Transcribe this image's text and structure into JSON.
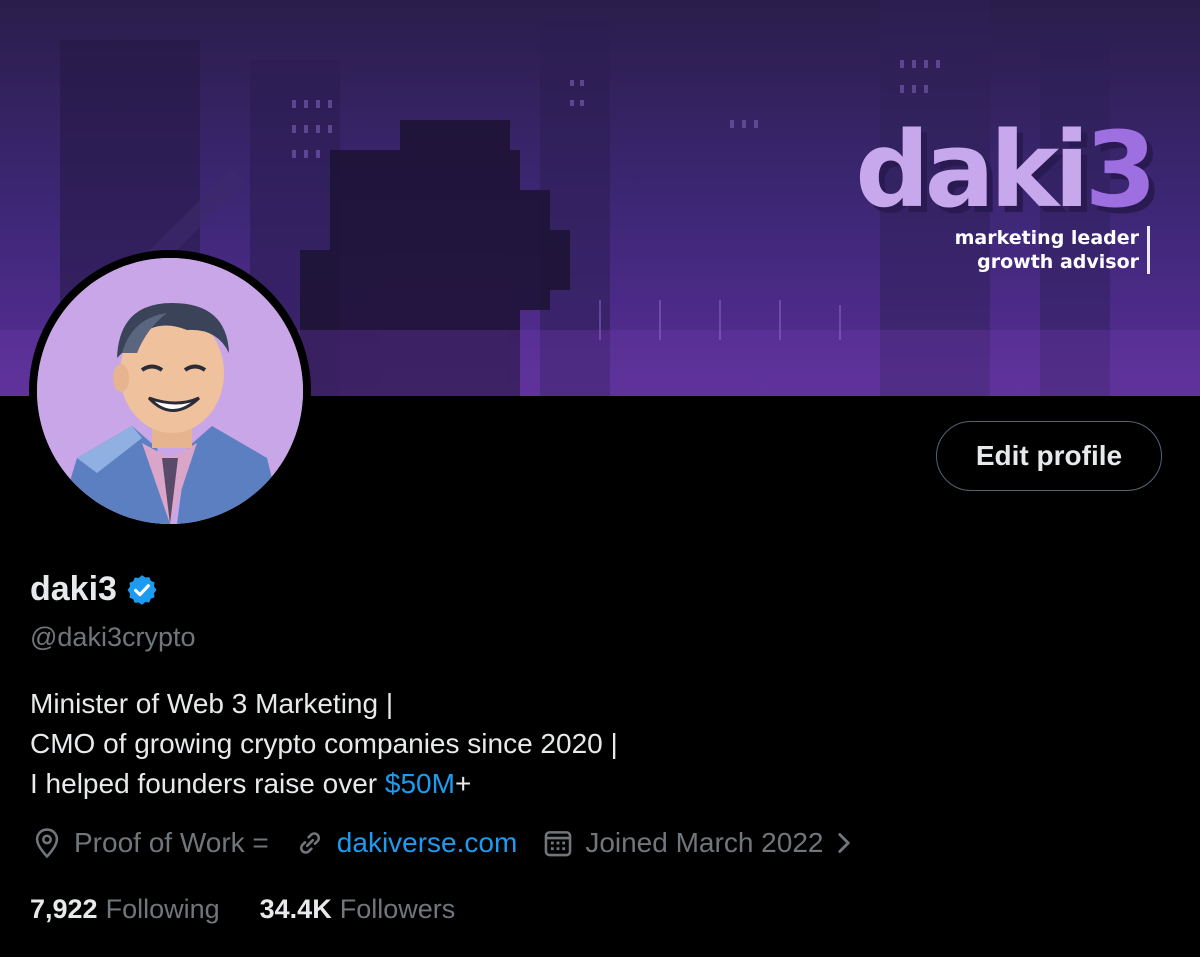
{
  "banner": {
    "brand_name_main": "daki",
    "brand_name_accent": "3",
    "tagline_line1": "marketing leader",
    "tagline_line2": "growth advisor"
  },
  "profile": {
    "display_name": "daki3",
    "handle": "@daki3crypto",
    "edit_button_label": "Edit profile",
    "verified": true
  },
  "bio": {
    "line1": "Minister of Web 3 Marketing |",
    "line2": "CMO of growing crypto companies since 2020 |",
    "line3_prefix": "I helped founders raise over ",
    "line3_cashtag": "$50M",
    "line3_suffix": "+"
  },
  "meta": {
    "location_icon": "location-pin-icon",
    "location": "Proof of Work =",
    "link_icon": "link-icon",
    "website": "dakiverse.com",
    "calendar_icon": "calendar-icon",
    "joined": "Joined March 2022",
    "chevron_icon": "chevron-right-icon"
  },
  "stats": {
    "following_count": "7,922",
    "following_label": "Following",
    "followers_count": "34.4K",
    "followers_label": "Followers"
  },
  "colors": {
    "background": "#000000",
    "primary_text": "#e7e9ea",
    "secondary_text": "#71767b",
    "link": "#1d9bf0",
    "verified_badge": "#1d9bf0",
    "banner_purple": "#4a2a86",
    "brand_lavender": "#c7a8ec",
    "avatar_bg": "#c9a6e8"
  }
}
